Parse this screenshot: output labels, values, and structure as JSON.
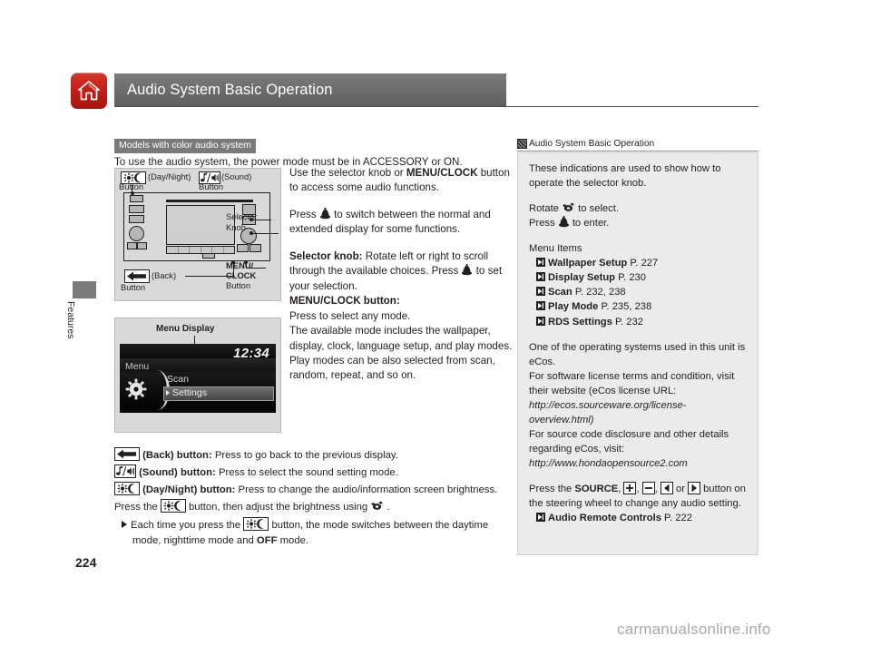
{
  "header": {
    "title": "Audio System Basic Operation",
    "home_icon": "home-icon"
  },
  "margin": {
    "section_label": "Features",
    "page_number": "224"
  },
  "watermark": "carmanualsonline.info",
  "main": {
    "models_banner": "Models with color audio system",
    "intro": "To use the audio system, the power mode must be in ACCESSORY or ON.",
    "figure_headunit": {
      "daynight_label": "(Day/Night)",
      "daynight_label2": "Button",
      "sound_label": "(Sound)",
      "sound_label2": "Button",
      "selector_label": "Selector",
      "selector_label2": "Knob",
      "menuclock_label": "MENU/",
      "menuclock_label2": "CLOCK",
      "menuclock_label3": "Button",
      "back_label": "(Back)",
      "back_label2": "Button"
    },
    "figure_menu": {
      "caption": "Menu Display",
      "clock": "12:34",
      "menu_word": "Menu",
      "item_scan": "Scan",
      "item_settings": "Settings"
    },
    "body": {
      "p1_a": "Use the selector knob or ",
      "p1_b": "MENU/CLOCK",
      "p1_c": " button to access some audio functions.",
      "p2_a": "Press ",
      "p2_b": " to switch between the normal and extended display for some functions.",
      "p3_label": "Selector knob:",
      "p3_a": " Rotate left or right to scroll through the available choices. Press ",
      "p3_b": " to set your selection.",
      "p4_label": "MENU/CLOCK button:",
      "p4_text": "Press to select any mode.",
      "p5_text": "The available mode includes the wallpaper, display, clock, language setup, and play modes. Play modes can be also selected from scan, random, repeat, and so on."
    },
    "notes": [
      {
        "icon": "back-button-icon",
        "label": "(Back) button:",
        "text": " Press to go back to the previous display."
      },
      {
        "icon": "sound-button-icon",
        "label": "(Sound) button:",
        "text": " Press to select the sound setting mode."
      },
      {
        "icon": "daynight-button-icon",
        "label": "(Day/Night) button:",
        "text": " Press to change the audio/information screen brightness."
      }
    ],
    "note_brightness_a": "Press the ",
    "note_brightness_b": " button, then adjust the brightness using ",
    "note_brightness_c": " .",
    "note_sub_a": "Each time you press the ",
    "note_sub_b": " button, the mode switches between the daytime mode, nighttime mode and ",
    "note_sub_bold": "OFF",
    "note_sub_c": " mode."
  },
  "sidebar": {
    "head_title": "Audio System Basic Operation",
    "p1": "These indications are used to show how to operate the selector knob.",
    "rotate_a": "Rotate ",
    "rotate_b": " to select.",
    "press_a": "Press ",
    "press_b": " to enter.",
    "menu_items_title": "Menu Items",
    "menu_items": [
      {
        "label": "Wallpaper Setup",
        "page": "P. 227"
      },
      {
        "label": "Display Setup",
        "page": "P. 230"
      },
      {
        "label": "Scan",
        "page": "P. 232, 238"
      },
      {
        "label": "Play Mode",
        "page": "P. 235, 238"
      },
      {
        "label": "RDS Settings",
        "page": "P. 232"
      }
    ],
    "ecos_p1": "One of the operating systems used in this unit is eCos.",
    "ecos_p2": "For software license terms and condition, visit their website (eCos license URL:",
    "ecos_url1": "http://ecos.sourceware.org/license-overview.html)",
    "ecos_p3": "For source code disclosure and other details regarding eCos, visit:",
    "ecos_url2": "http://www.hondaopensource2.com",
    "steering_a": "Press the ",
    "steering_source": "SOURCE",
    "steering_b": ", ",
    "steering_c": ", ",
    "steering_d": ", ",
    "steering_or": " or ",
    "steering_e": " button on the steering wheel to change any audio setting.",
    "remote_link": "Audio Remote Controls",
    "remote_page": "P. 222"
  },
  "colors": {
    "brand_red": "#c22019",
    "header_gray": "#6d6d6d",
    "banner_gray": "#7a7a7a",
    "sidebar_bg": "#ebebeb",
    "figure_bg": "#d9d9d9"
  }
}
